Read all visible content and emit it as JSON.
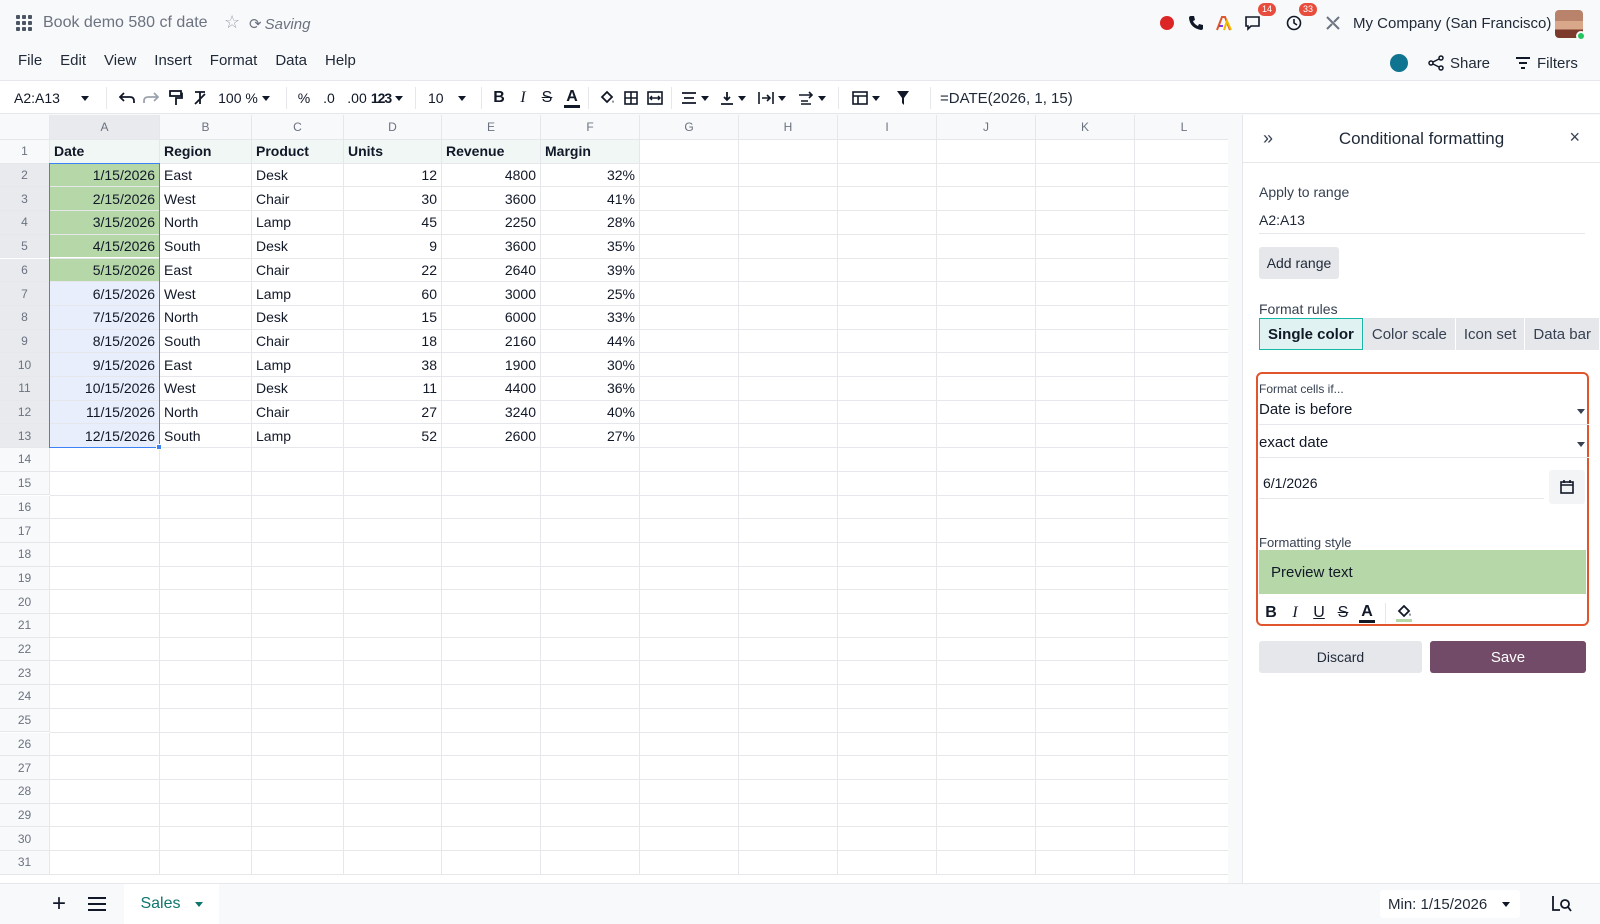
{
  "topbar": {
    "doc_title": "Book demo 580 cf date",
    "saving_status": "Saving",
    "messages_badge": "14",
    "activities_badge": "33",
    "company": "My Company (San Francisco)"
  },
  "menu": [
    "File",
    "Edit",
    "View",
    "Insert",
    "Format",
    "Data",
    "Help"
  ],
  "actions": {
    "share": "Share",
    "filters": "Filters"
  },
  "toolbar": {
    "cell_ref": "A2:A13",
    "zoom": "100 %",
    "percent": "%",
    "dec_decrease": ".0",
    "dec_increase": ".00",
    "more_formats": "123",
    "font_size": "10",
    "formula": "=DATE(2026, 1, 15)"
  },
  "sheet": {
    "columns": [
      "A",
      "B",
      "C",
      "D",
      "E",
      "F",
      "G",
      "H",
      "I",
      "J",
      "K",
      "L"
    ],
    "header_row": [
      "Date",
      "Region",
      "Product",
      "Units",
      "Revenue",
      "Margin"
    ],
    "rows": [
      [
        "1/15/2026",
        "East",
        "Desk",
        "12",
        "4800",
        "32%"
      ],
      [
        "2/15/2026",
        "West",
        "Chair",
        "30",
        "3600",
        "41%"
      ],
      [
        "3/15/2026",
        "North",
        "Lamp",
        "45",
        "2250",
        "28%"
      ],
      [
        "4/15/2026",
        "South",
        "Desk",
        "9",
        "3600",
        "35%"
      ],
      [
        "5/15/2026",
        "East",
        "Chair",
        "22",
        "2640",
        "39%"
      ],
      [
        "6/15/2026",
        "West",
        "Lamp",
        "60",
        "3000",
        "25%"
      ],
      [
        "7/15/2026",
        "North",
        "Desk",
        "15",
        "6000",
        "33%"
      ],
      [
        "8/15/2026",
        "South",
        "Chair",
        "18",
        "2160",
        "44%"
      ],
      [
        "9/15/2026",
        "East",
        "Lamp",
        "38",
        "1900",
        "30%"
      ],
      [
        "10/15/2026",
        "West",
        "Desk",
        "11",
        "4400",
        "36%"
      ],
      [
        "11/15/2026",
        "North",
        "Chair",
        "27",
        "3240",
        "40%"
      ],
      [
        "12/15/2026",
        "South",
        "Lamp",
        "52",
        "2600",
        "27%"
      ]
    ],
    "row_count": 31,
    "highlight_color": "#b6d7a8"
  },
  "panel": {
    "title": "Conditional formatting",
    "apply_label": "Apply to range",
    "range": "A2:A13",
    "add_range": "Add range",
    "rules_label": "Format rules",
    "tabs": [
      "Single color",
      "Color scale",
      "Icon set",
      "Data bar"
    ],
    "condition_label": "Format cells if...",
    "condition": "Date is before",
    "date_type": "exact date",
    "date_value": "6/1/2026",
    "style_label": "Formatting style",
    "preview": "Preview text",
    "discard": "Discard",
    "save": "Save",
    "accent_color": "#714b67"
  },
  "bottom": {
    "sheet_name": "Sales",
    "aggregate": "Min: 1/15/2026"
  }
}
